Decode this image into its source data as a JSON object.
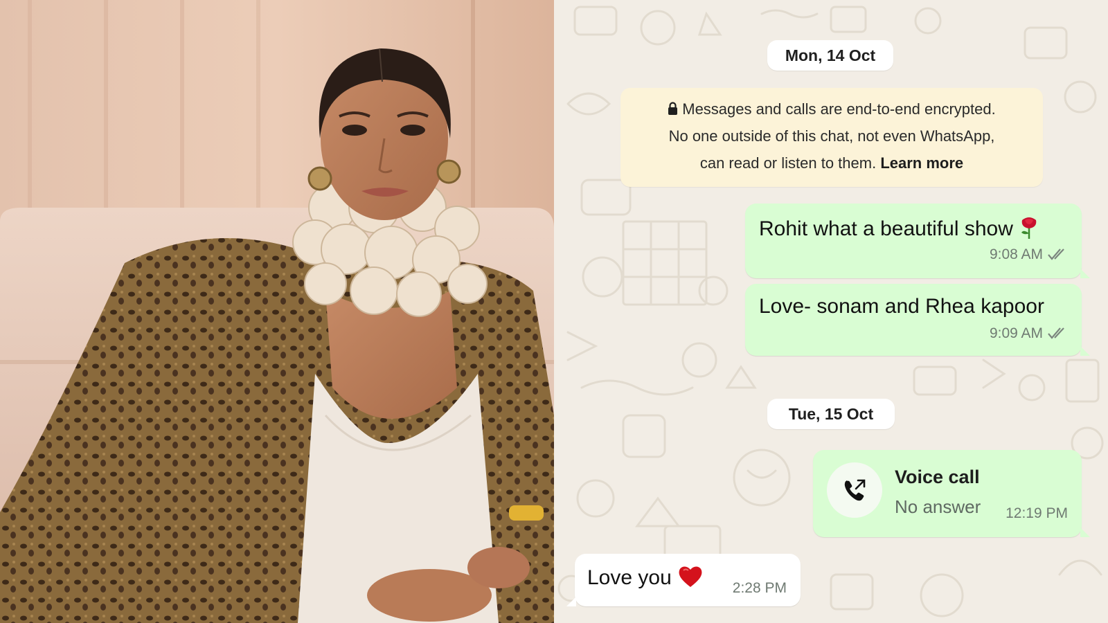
{
  "photo": {
    "description_icon": "portrait-photo"
  },
  "chat": {
    "date_separators": [
      "Mon, 14 Oct",
      "Tue, 15 Oct"
    ],
    "encryption_notice": {
      "line1": "Messages and calls are end-to-end encrypted.",
      "line2": "No one outside of this chat, not even WhatsApp,",
      "line3": "can read or listen to them.",
      "link": "Learn more",
      "icon": "lock-icon"
    },
    "messages": [
      {
        "direction": "outgoing",
        "text": "Rohit what a beautiful show",
        "emoji_icon": "rose-icon",
        "time": "9:08 AM",
        "status_icon": "double-check-icon"
      },
      {
        "direction": "outgoing",
        "text": "Love- sonam and Rhea kapoor",
        "time": "9:09 AM",
        "status_icon": "double-check-icon"
      },
      {
        "direction": "outgoing",
        "type": "call",
        "title": "Voice call",
        "status": "No answer",
        "time": "12:19 PM",
        "icon": "outgoing-call-icon"
      },
      {
        "direction": "incoming",
        "text": "Love you",
        "emoji_icon": "red-heart-icon",
        "time": "2:28 PM"
      }
    ],
    "colors": {
      "outgoing_bubble": "#d9fdd3",
      "incoming_bubble": "#ffffff",
      "notice_bubble": "#fcf3d8",
      "wallpaper": "#f2ede5"
    }
  }
}
